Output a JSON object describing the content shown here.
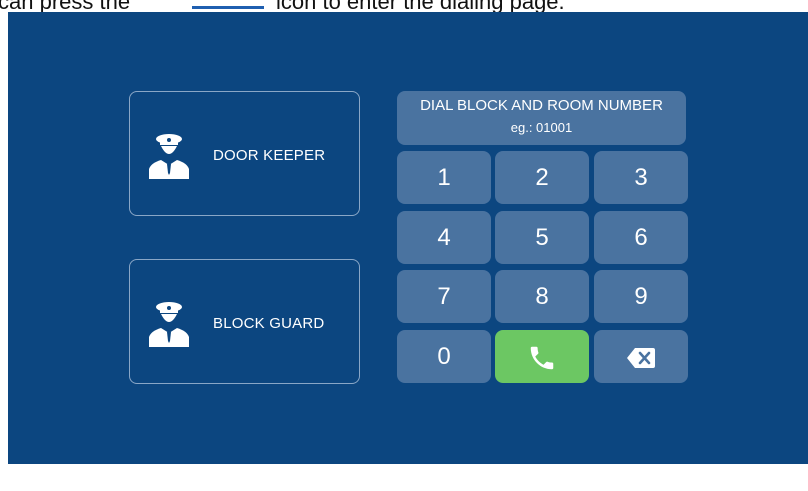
{
  "doc_text": {
    "before": "can press the",
    "after": "icon to enter the dialing page."
  },
  "left_buttons": [
    {
      "label": "DOOR  KEEPER",
      "icon": "guard-icon"
    },
    {
      "label": "BLOCK GUARD",
      "icon": "guard-icon"
    }
  ],
  "dial_header": {
    "title": "DIAL BLOCK AND ROOM NUMBER",
    "example": "eg.: 01001"
  },
  "keypad": {
    "k1": "1",
    "k2": "2",
    "k3": "3",
    "k4": "4",
    "k5": "5",
    "k6": "6",
    "k7": "7",
    "k8": "8",
    "k9": "9",
    "k0": "0",
    "call_icon": "phone-icon",
    "backspace_icon": "backspace-icon"
  },
  "colors": {
    "background": "#0c4680",
    "key": "#4a73a0",
    "call": "#6cc763"
  }
}
